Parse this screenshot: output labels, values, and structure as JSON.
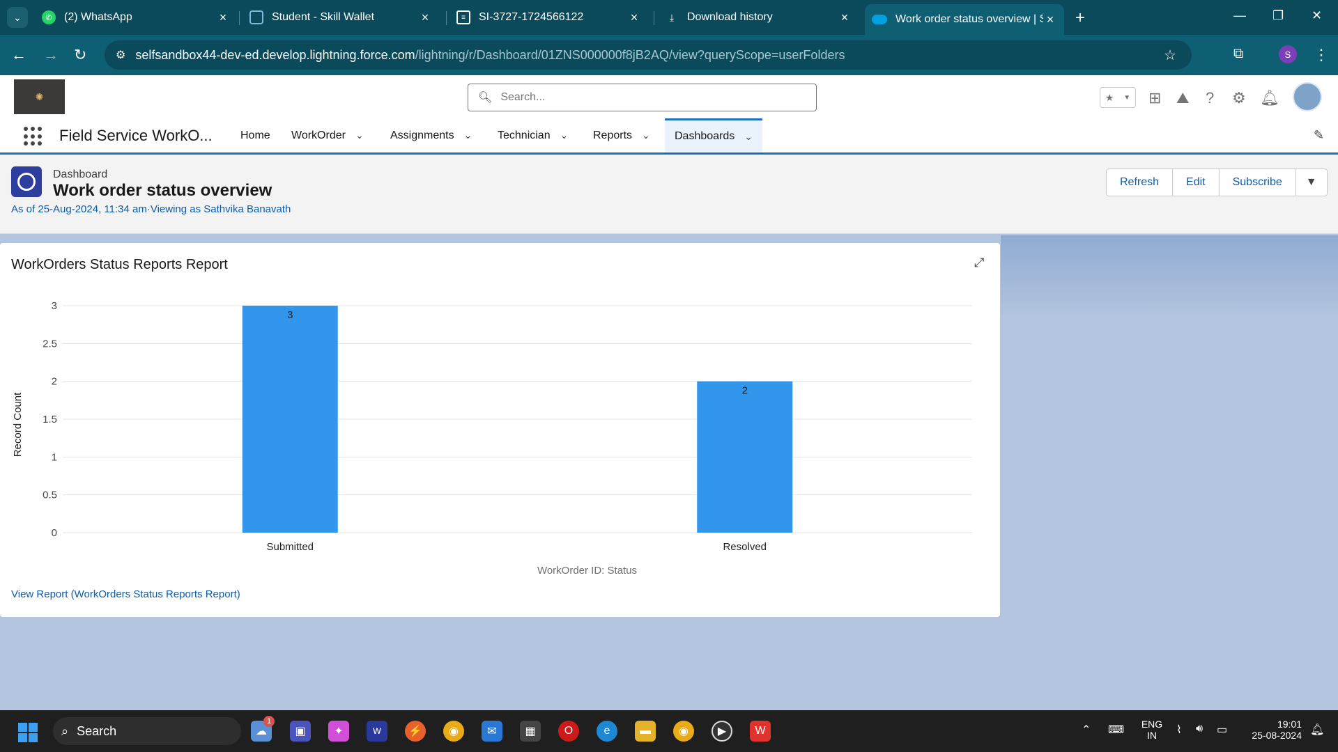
{
  "browser": {
    "tabs": [
      {
        "label": "(2) WhatsApp",
        "icon": "whatsapp-icon"
      },
      {
        "label": "Student - Skill Wallet",
        "icon": "skillwallet-icon"
      },
      {
        "label": "SI-3727-1724566122",
        "icon": "document-icon"
      },
      {
        "label": "Download history",
        "icon": "download-icon"
      },
      {
        "label": "Work order status overview | Sa",
        "icon": "salesforce-cloud-icon"
      }
    ],
    "url_host": "selfsandbox44-dev-ed.develop.lightning.force.com",
    "url_path": "/lightning/r/Dashboard/01ZNS000000f8jB2AQ/view?queryScope=userFolders",
    "profile_initial": "S"
  },
  "header": {
    "search_placeholder": "Search..."
  },
  "appnav": {
    "app_name": "Field Service WorkO...",
    "items": [
      {
        "label": "Home",
        "has_menu": false
      },
      {
        "label": "WorkOrder",
        "has_menu": true
      },
      {
        "label": "Assignments",
        "has_menu": true
      },
      {
        "label": "Technician",
        "has_menu": true
      },
      {
        "label": "Reports",
        "has_menu": true
      },
      {
        "label": "Dashboards",
        "has_menu": true,
        "active": true
      }
    ]
  },
  "dashboard": {
    "eyebrow": "Dashboard",
    "title": "Work order status overview",
    "meta": "As of 25-Aug-2024, 11:34 am·Viewing as Sathvika Banavath",
    "buttons": {
      "refresh": "Refresh",
      "edit": "Edit",
      "subscribe": "Subscribe"
    }
  },
  "card": {
    "title": "WorkOrders Status Reports Report",
    "view_report": "View Report (WorkOrders Status Reports Report)"
  },
  "chart_data": {
    "type": "bar",
    "categories": [
      "Submitted",
      "Resolved"
    ],
    "values": [
      3,
      2
    ],
    "xlabel": "WorkOrder ID: Status",
    "ylabel": "Record Count",
    "ylim": [
      0,
      3
    ],
    "yticks": [
      "0",
      "0.5",
      "1",
      "1.5",
      "2",
      "2.5",
      "3"
    ],
    "bar_color": "#3296ed",
    "grid": true
  },
  "taskbar": {
    "search_label": "Search",
    "lang_top": "ENG",
    "lang_bottom": "IN",
    "time": "19:01",
    "date": "25-08-2024",
    "widget_badge": "1"
  },
  "colors": {
    "brand_blue": "#0b5cab",
    "nav_active_border": "#1b6fc4",
    "browser_frame": "#0e5f73"
  }
}
